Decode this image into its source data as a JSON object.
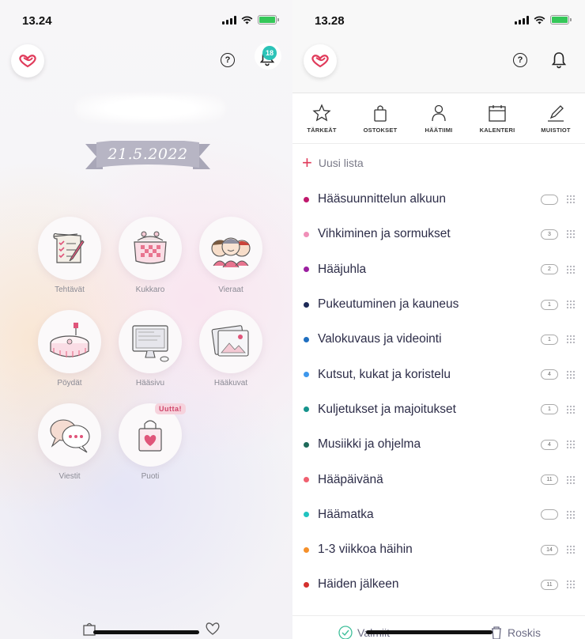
{
  "left_screen": {
    "status_time": "13.24",
    "notification_count": "18",
    "help_label": "?",
    "wedding_date": "21.5.2022",
    "tiles": [
      {
        "label": "Tehtävät"
      },
      {
        "label": "Kukkaro"
      },
      {
        "label": "Vieraat"
      },
      {
        "label": "Pöydät"
      },
      {
        "label": "Hääsivu"
      },
      {
        "label": "Hääkuvat"
      },
      {
        "label": "Viestit"
      },
      {
        "label": "Puoti"
      }
    ],
    "new_badge": "Uutta!"
  },
  "right_screen": {
    "status_time": "13.28",
    "help_label": "?",
    "tabs": [
      {
        "label": "TÄRKEÄT",
        "icon": "star-icon"
      },
      {
        "label": "OSTOKSET",
        "icon": "shopping-bag-icon"
      },
      {
        "label": "HÄÄTIIMI",
        "icon": "person-icon"
      },
      {
        "label": "KALENTERI",
        "icon": "calendar-icon"
      },
      {
        "label": "MUISTIOT",
        "icon": "pen-icon"
      }
    ],
    "new_list_label": "Uusi lista",
    "lists": [
      {
        "name": "Hääsuunnittelun alkuun",
        "count": "",
        "color": "#c0186c"
      },
      {
        "name": "Vihkiminen ja sormukset",
        "count": "3",
        "color": "#f08fb8"
      },
      {
        "name": "Hääjuhla",
        "count": "2",
        "color": "#9b1fa0"
      },
      {
        "name": "Pukeutuminen ja kauneus",
        "count": "1",
        "color": "#1d2a57"
      },
      {
        "name": "Valokuvaus ja videointi",
        "count": "1",
        "color": "#1f6fc0"
      },
      {
        "name": "Kutsut, kukat ja koristelu",
        "count": "4",
        "color": "#3d97ec"
      },
      {
        "name": "Kuljetukset ja majoitukset",
        "count": "1",
        "color": "#16938c"
      },
      {
        "name": "Musiikki ja ohjelma",
        "count": "4",
        "color": "#1e6a5a"
      },
      {
        "name": "Hääpäivänä",
        "count": "11",
        "color": "#f06070"
      },
      {
        "name": "Häämatka",
        "count": "",
        "color": "#21c3c0"
      },
      {
        "name": "1-3 viikkoa häihin",
        "count": "14",
        "color": "#f5902a"
      },
      {
        "name": "Häiden jälkeen",
        "count": "11",
        "color": "#d4302e"
      }
    ],
    "footer": {
      "done_label": "Valmiit",
      "trash_label": "Roskis"
    }
  },
  "colors": {
    "brand_pink": "#e03a5a",
    "badge_teal": "#2cc3b8",
    "ribbon_gray": "#b7b5c4"
  }
}
